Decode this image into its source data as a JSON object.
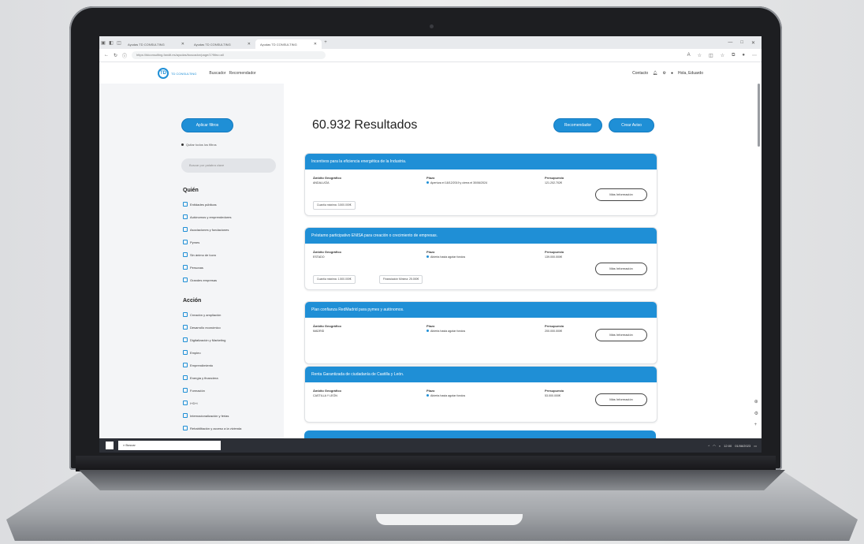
{
  "browser": {
    "tabs": [
      {
        "title": "Ayudas TD CONSULTING"
      },
      {
        "title": "Ayudas TD CONSULTING"
      },
      {
        "title": "Ayudas TD CONSULTING"
      }
    ],
    "url": "https://tdconsulting.fandit.es/ayudas/buscador/page/1?filtro=all",
    "window_controls": [
      "—",
      "□",
      "✕"
    ]
  },
  "site": {
    "logo_letters": "TD",
    "logo_text": "TD CONSULTING",
    "nav": [
      "Buscador",
      "Recomendador"
    ],
    "header_right": {
      "contact": "Contacto",
      "user": "Hola, Eduardo"
    }
  },
  "sidebar": {
    "apply_filters": "Aplicar filtros",
    "remove_filters": "Quitar todos los filtros",
    "search_placeholder": "Buscar por palabra clave",
    "quien": {
      "title": "Quién",
      "items": [
        "Entidades públicas",
        "Autónomos y emprendedores",
        "Asociaciones y fundaciones",
        "Pymes",
        "Sin ánimo de lucro",
        "Personas",
        "Grandes empresas"
      ]
    },
    "accion": {
      "title": "Acción",
      "items": [
        "Creación y ampliación",
        "Desarrollo económico",
        "Digitalización y Marketing",
        "Empleo",
        "Emprendimiento",
        "Energía y financiera",
        "Formación",
        "I+D+i",
        "Internacionalización y ferias",
        "Rehabilitación y acceso a la vivienda",
        "Servicios sociales"
      ]
    }
  },
  "main": {
    "results_title": "60.932 Resultados",
    "recommender_button": "Recomendador",
    "alert_button": "Crear Aviso",
    "more_info_label": "Más Información",
    "labels": {
      "ambito": "Ámbito Geográfico",
      "plazo": "Plazo",
      "presupuesto": "Presupuesto"
    },
    "cards": [
      {
        "title": "Incentivos para la eficiencia energética de la Industria.",
        "ambito": "ANDALUCÍA",
        "plazo": "Apertura el 18/12/2019 y cierra el 30/06/2024",
        "presupuesto": "121.202.702€",
        "tags": [
          "Cuantía máxima: 3.500.000€"
        ]
      },
      {
        "title": "Préstamo participativo ENISA para creación o crecimiento de empresas.",
        "ambito": "ESTADO",
        "plazo": "Abierta hasta agotar fondos",
        "presupuesto": "139.000.000€",
        "tags": [
          "Cuantía máxima: 1.500.000€",
          "Financiación Mínima: 25.000€"
        ]
      },
      {
        "title": "Plan confianza RedMadrid para pymes y autónomos.",
        "ambito": "MADRID",
        "plazo": "Abierta hasta agotar fondos",
        "presupuesto": "200.000.000€",
        "tags": []
      },
      {
        "title": "Renta Garantizada de ciudadanía de Castilla y León.",
        "ambito": "CASTILLA Y LEÓN",
        "plazo": "Abierta hasta agotar fondos",
        "presupuesto": "53.000.000€",
        "tags": []
      }
    ]
  },
  "taskbar": {
    "search": "Buscar",
    "time": "12:00",
    "date": "01/08/2023"
  }
}
